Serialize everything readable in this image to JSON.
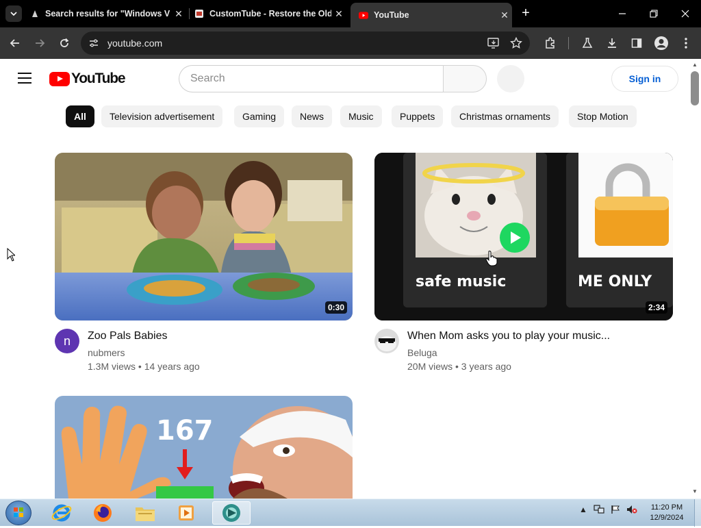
{
  "browser": {
    "tabs": [
      {
        "title": "Search results for \"Windows V",
        "active": false
      },
      {
        "title": "CustomTube - Restore the Old",
        "active": false
      },
      {
        "title": "YouTube",
        "active": true
      }
    ],
    "address": "youtube.com"
  },
  "header": {
    "logo_text": "YouTube",
    "search_placeholder": "Search",
    "signin_label": "Sign in"
  },
  "chips": [
    "All",
    "Television advertisement",
    "Gaming",
    "News",
    "Music",
    "Puppets",
    "Christmas ornaments",
    "Stop Motion"
  ],
  "videos": [
    {
      "title": "Zoo Pals Babies",
      "channel": "nubmers",
      "meta": "1.3M views • 14 years ago",
      "duration": "0:30",
      "avatar_letter": "n"
    },
    {
      "title": "When Mom asks you to play your music...",
      "channel": "Beluga",
      "meta": "20M views • 3 years ago",
      "duration": "2:34",
      "thumb_text_left": "safe music",
      "thumb_text_right": "ME ONLY"
    },
    {
      "thumb_number": "167"
    }
  ],
  "taskbar": {
    "time": "11:20 PM",
    "date": "12/9/2024"
  },
  "colors": {
    "yt_red": "#ff0000",
    "link_blue": "#065fd4",
    "chrome_dark": "#353535"
  }
}
